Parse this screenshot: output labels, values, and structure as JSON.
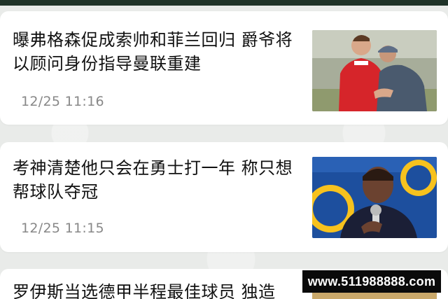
{
  "news": [
    {
      "title": "曝弗格森促成索帅和菲兰回归 爵爷将以顾问身份指导曼联重建",
      "time": "12/25 11:16",
      "image": "training-ground-photo"
    },
    {
      "title": "考神清楚他只会在勇士打一年 称只想帮球队夺冠",
      "time": "12/25 11:15",
      "image": "press-conference-photo"
    },
    {
      "title": "罗伊斯当选德甲半程最佳球员 独造",
      "image": "player-photo"
    }
  ],
  "watermark": "www.511988888.com",
  "colors": {
    "top_bar": "#1f3328",
    "background": "#e9ebe9",
    "title": "#111111",
    "time": "#888888"
  }
}
